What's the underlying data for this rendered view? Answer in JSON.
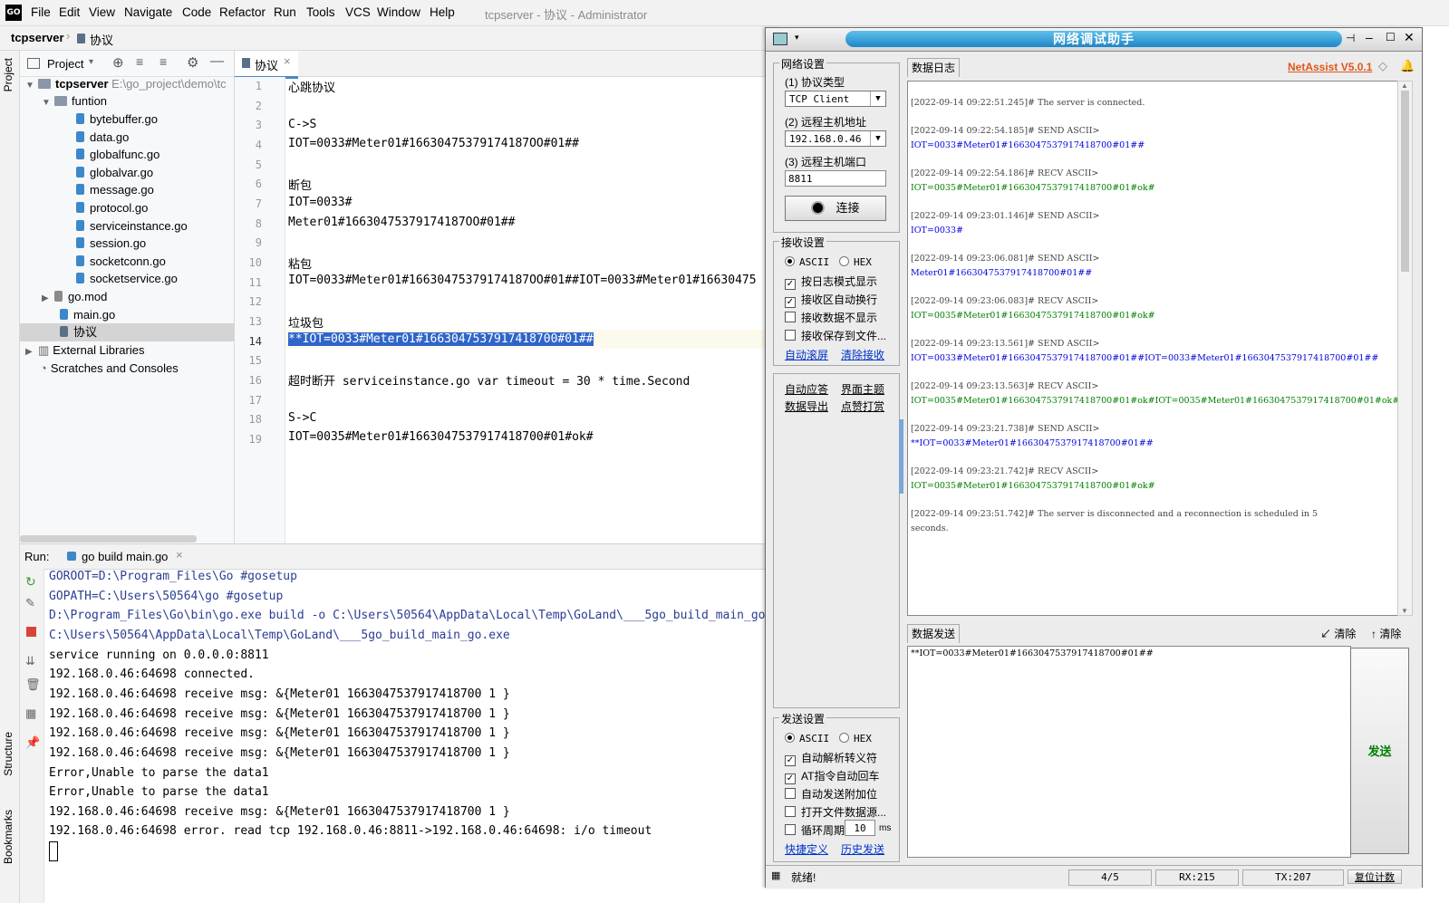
{
  "ide": {
    "logo": "GO",
    "menu": [
      "File",
      "Edit",
      "View",
      "Navigate",
      "Code",
      "Refactor",
      "Run",
      "Tools",
      "VCS",
      "Window",
      "Help"
    ],
    "window_title": "tcpserver - 协议 - Administrator",
    "breadcrumb": {
      "project": "tcpserver",
      "file": "协议"
    },
    "left_tabs": {
      "project": "Project",
      "structure": "Structure",
      "bookmarks": "Bookmarks"
    },
    "project_panel": {
      "title": "Project",
      "root": {
        "name": "tcpserver",
        "path": "E:\\go_project\\demo\\tc"
      },
      "folder": "funtion",
      "files": [
        "bytebuffer.go",
        "data.go",
        "globalfunc.go",
        "globalvar.go",
        "message.go",
        "protocol.go",
        "serviceinstance.go",
        "session.go",
        "socketconn.go",
        "socketservice.go"
      ],
      "root_files": [
        "go.mod",
        "main.go",
        "协议"
      ],
      "external": "External Libraries",
      "scratches": "Scratches and Consoles"
    },
    "editor": {
      "tab": "协议",
      "line_numbers": [
        "1",
        "2",
        "3",
        "4",
        "5",
        "6",
        "7",
        "8",
        "9",
        "10",
        "11",
        "12",
        "13",
        "14",
        "15",
        "16",
        "17",
        "18",
        "19"
      ],
      "lines": [
        "心跳协议",
        "",
        "C->S",
        "IOT=0033#Meter01#16630475379174187OO#01##",
        "",
        "断包",
        "IOT=0033#",
        "Meter01#16630475379174187OO#01##",
        "",
        "粘包",
        "IOT=0033#Meter01#16630475379174187OO#01##IOT=0033#Meter01#16630475",
        "",
        "垃圾包",
        "**IOT=0033#Meter01#1663047537917418700#01##",
        "",
        "超时断开 serviceinstance.go var timeout = 30 * time.Second",
        "",
        "S->C",
        "IOT=0035#Meter01#1663047537917418700#01#ok#"
      ]
    },
    "run": {
      "label": "Run:",
      "tab": "go build main.go",
      "output": [
        {
          "text": "GOROOT=D:\\Program_Files\\Go #gosetup",
          "style": "blue"
        },
        {
          "text": "GOPATH=C:\\Users\\50564\\go #gosetup",
          "style": "blue"
        },
        {
          "text": "D:\\Program_Files\\Go\\bin\\go.exe build -o C:\\Users\\50564\\AppData\\Local\\Temp\\GoLand\\___5go_build_main_go",
          "style": "blue"
        },
        {
          "text": "C:\\Users\\50564\\AppData\\Local\\Temp\\GoLand\\___5go_build_main_go.exe",
          "style": "blue"
        },
        {
          "text": "service running on 0.0.0.0:8811",
          "style": "plain"
        },
        {
          "text": "192.168.0.46:64698 connected.",
          "style": "plain"
        },
        {
          "text": "192.168.0.46:64698 receive msg: &{Meter01 1663047537917418700 1 }",
          "style": "plain"
        },
        {
          "text": "192.168.0.46:64698 receive msg: &{Meter01 1663047537917418700 1 }",
          "style": "plain"
        },
        {
          "text": "192.168.0.46:64698 receive msg: &{Meter01 1663047537917418700 1 }",
          "style": "plain"
        },
        {
          "text": "192.168.0.46:64698 receive msg: &{Meter01 1663047537917418700 1 }",
          "style": "plain"
        },
        {
          "text": "Error,Unable to parse the data1",
          "style": "plain"
        },
        {
          "text": "Error,Unable to parse the data1",
          "style": "plain"
        },
        {
          "text": "192.168.0.46:64698 receive msg: &{Meter01 1663047537917418700 1 }",
          "style": "plain"
        },
        {
          "text": "192.168.0.46:64698 error. read tcp 192.168.0.46:8811->192.168.0.46:64698: i/o timeout",
          "style": "plain"
        }
      ]
    }
  },
  "netassist": {
    "title": "网络调试助手",
    "version": "NetAssist V5.0.1",
    "net_settings": {
      "group": "网络设置",
      "protocol_label": "(1) 协议类型",
      "protocol_value": "TCP Client",
      "host_label": "(2) 远程主机地址",
      "host_value": "192.168.0.46",
      "port_label": "(3) 远程主机端口",
      "port_value": "8811",
      "connect": "连接"
    },
    "recv_settings": {
      "group": "接收设置",
      "ascii": "ASCII",
      "hex": "HEX",
      "opt1": "按日志模式显示",
      "opt2": "接收区自动换行",
      "opt3": "接收数据不显示",
      "opt4": "接收保存到文件...",
      "scroll": "自动滚屏",
      "clear": "清除接收"
    },
    "misc": {
      "auto_reply": "自动应答",
      "theme": "界面主题",
      "export": "数据导出",
      "tip": "点赞打赏"
    },
    "log_tab": "数据日志",
    "log": [
      {
        "text": "[2022-09-14 09:22:51.245]# The server is connected.",
        "style": "lg"
      },
      {
        "text": "[2022-09-14 09:22:54.185]# SEND ASCII>",
        "style": "lg"
      },
      {
        "text": "IOT=0033#Meter01#1663047537917418700#01##",
        "style": "lb"
      },
      {
        "text": "[2022-09-14 09:22:54.186]# RECV ASCII>",
        "style": "lg"
      },
      {
        "text": "IOT=0035#Meter01#1663047537917418700#01#ok#",
        "style": "lgr"
      },
      {
        "text": "[2022-09-14 09:23:01.146]# SEND ASCII>",
        "style": "lg"
      },
      {
        "text": "IOT=0033#",
        "style": "lb"
      },
      {
        "text": "[2022-09-14 09:23:06.081]# SEND ASCII>",
        "style": "lg"
      },
      {
        "text": "Meter01#1663047537917418700#01##",
        "style": "lb"
      },
      {
        "text": "[2022-09-14 09:23:06.083]# RECV ASCII>",
        "style": "lg"
      },
      {
        "text": "IOT=0035#Meter01#1663047537917418700#01#ok#",
        "style": "lgr"
      },
      {
        "text": "[2022-09-14 09:23:13.561]# SEND ASCII>",
        "style": "lg"
      },
      {
        "text": "IOT=0033#Meter01#1663047537917418700#01##IOT=0033#Meter01#1663047537917418700#01##",
        "style": "lb"
      },
      {
        "text": "[2022-09-14 09:23:13.563]# RECV ASCII>",
        "style": "lg"
      },
      {
        "text": "IOT=0035#Meter01#1663047537917418700#01#ok#IOT=0035#Meter01#1663047537917418700#01#ok#",
        "style": "lgr"
      },
      {
        "text": "[2022-09-14 09:23:21.738]# SEND ASCII>",
        "style": "lg"
      },
      {
        "text": "**IOT=0033#Meter01#1663047537917418700#01##",
        "style": "lb"
      },
      {
        "text": "[2022-09-14 09:23:21.742]# RECV ASCII>",
        "style": "lg"
      },
      {
        "text": "IOT=0035#Meter01#1663047537917418700#01#ok#",
        "style": "lgr"
      },
      {
        "text": "[2022-09-14 09:23:51.742]# The server is disconnected and a reconnection is scheduled in 5",
        "style": "lg"
      },
      {
        "text": "seconds.",
        "style": "lg"
      }
    ],
    "send_tab": "数据发送",
    "send_clear1": "清除",
    "send_clear2": "清除",
    "send_content": "**IOT=0033#Meter01#1663047537917418700#01##",
    "send_button": "发送",
    "send_settings": {
      "group": "发送设置",
      "ascii": "ASCII",
      "hex": "HEX",
      "opt1": "自动解析转义符",
      "opt2": "AT指令自动回车",
      "opt3": "自动发送附加位",
      "opt4": "打开文件数据源...",
      "opt5": "循环周期",
      "period": "10",
      "unit": "ms",
      "shortcut": "快捷定义",
      "history": "历史发送"
    },
    "status": {
      "ready": "就绪!",
      "count": "4/5",
      "rx": "RX:215",
      "tx": "TX:207",
      "reset": "复位计数"
    }
  }
}
